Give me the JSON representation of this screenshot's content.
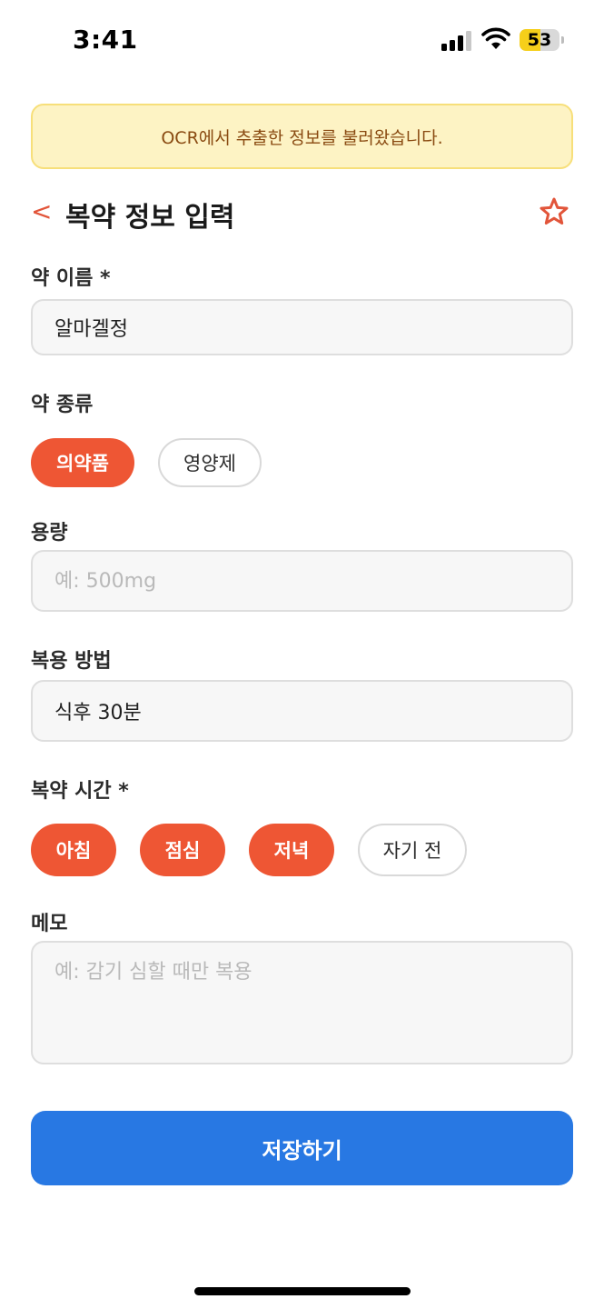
{
  "status_bar": {
    "time": "3:41",
    "battery": "53",
    "battery_level": 0.53
  },
  "banner": {
    "text": "OCR에서 추출한 정보를 불러왔습니다."
  },
  "header": {
    "back_icon": "<",
    "title": "복약 정보 입력",
    "favorite_icon": "star-outline-icon"
  },
  "form": {
    "drug_name": {
      "label": "약 이름 *",
      "value": "알마겔정"
    },
    "drug_type": {
      "label": "약 종류",
      "options": [
        {
          "label": "의약품",
          "selected": true
        },
        {
          "label": "영양제",
          "selected": false
        }
      ]
    },
    "dosage": {
      "label": "용량",
      "value": "",
      "placeholder": "예: 500mg"
    },
    "method": {
      "label": "복용 방법",
      "value": "식후 30분"
    },
    "time": {
      "label": "복약 시간 *",
      "options": [
        {
          "label": "아침",
          "selected": true
        },
        {
          "label": "점심",
          "selected": true
        },
        {
          "label": "저녁",
          "selected": true
        },
        {
          "label": "자기 전",
          "selected": false
        }
      ]
    },
    "memo": {
      "label": "메모",
      "value": "",
      "placeholder": "예: 감기 심할 때만 복용"
    }
  },
  "save_button": {
    "label": "저장하기"
  },
  "colors": {
    "accent": "#EE5634",
    "primary": "#2878E3",
    "banner_bg": "#FDF3C4",
    "banner_text": "#8A4B12"
  }
}
